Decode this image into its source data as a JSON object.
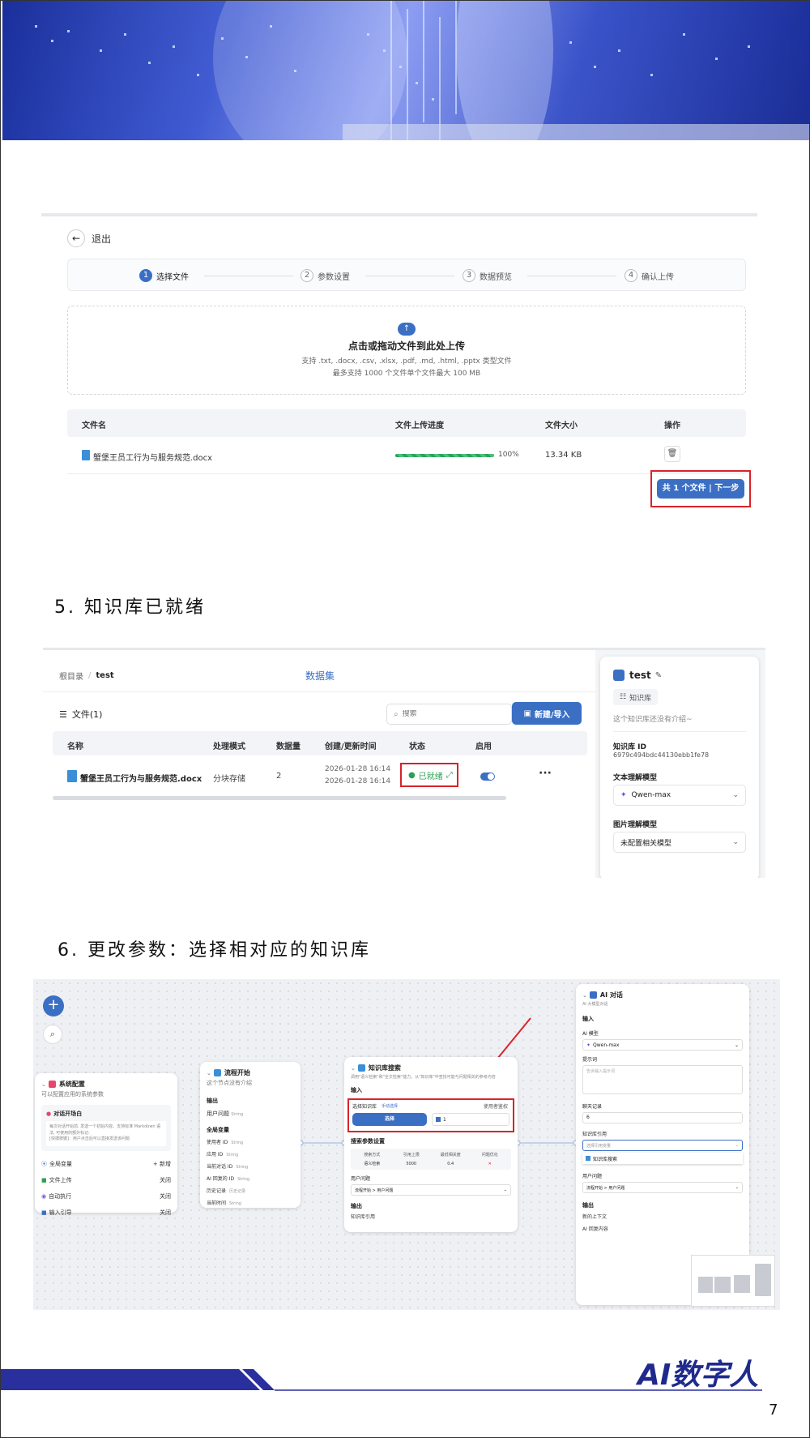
{
  "upload_screen": {
    "back_label": "退出",
    "steps": [
      "选择文件",
      "参数设置",
      "数据预览",
      "确认上传"
    ],
    "step_numbers": [
      "1",
      "2",
      "3",
      "4"
    ],
    "dropzone": {
      "title": "点击或拖动文件到此处上传",
      "line1": "支持 .txt, .docx, .csv, .xlsx, .pdf, .md, .html, .pptx 类型文件",
      "line2": "最多支持 1000 个文件单个文件最大 100 MB"
    },
    "table_headers": {
      "name": "文件名",
      "progress": "文件上传进度",
      "size": "文件大小",
      "action": "操作"
    },
    "file": {
      "name": "蟹堡王员工行为与服务规范.docx",
      "progress": 1.0,
      "progress_label": "100%",
      "size": "13.34 KB"
    },
    "next_button": "共 1 个文件 | 下一步"
  },
  "section5_title": "5. 知识库已就绪",
  "dataset_screen": {
    "breadcrumb_root": "根目录",
    "breadcrumb_current": "test",
    "tab": "数据集",
    "files_label": "文件(1)",
    "search_placeholder": "搜索",
    "new_button": "新建/导入",
    "headers": {
      "name": "名称",
      "mode": "处理模式",
      "count": "数据量",
      "time": "创建/更新时间",
      "status": "状态",
      "enabled": "启用"
    },
    "row": {
      "name": "蟹堡王员工行为与服务规范.docx",
      "mode": "分块存储",
      "count": "2",
      "created": "2026-01-28 16:14",
      "updated": "2026-01-28 16:14",
      "status": "已就绪",
      "more": "···"
    },
    "side": {
      "title": "test",
      "type": "知识库",
      "intro": "这个知识库还没有介绍~",
      "id_label": "知识库 ID",
      "id_value": "6979c494bdc44130ebb1fe78",
      "text_model_label": "文本理解模型",
      "text_model_value": "Qwen-max",
      "image_model_label": "图片理解模型",
      "image_model_value": "未配置相关模型"
    }
  },
  "section6_title": "6. 更改参数：选择相对应的知识库",
  "workflow_screen": {
    "sys_config": {
      "title": "系统配置",
      "subtitle": "可以配置应用的系统参数",
      "opening_label": "对话开场白",
      "opening_desc": "每次对话开始前, 发送一个初始内容。支持标准 Markdown 语法, 可使用的额外标记:\n[快捷按键]：用户点击后可以直接发送该问题",
      "items": [
        {
          "label": "全局变量",
          "value": "+ 新增"
        },
        {
          "label": "文件上传",
          "value": "关闭"
        },
        {
          "label": "自动执行",
          "value": "关闭"
        },
        {
          "label": "输入引导",
          "value": "关闭"
        }
      ]
    },
    "flow_start": {
      "title": "流程开始",
      "subtitle": "这个节点没有介绍",
      "output_label": "输出",
      "output_item": "用户问题",
      "global_label": "全局变量",
      "vars": [
        "使用者 ID",
        "应用 ID",
        "当前对话 ID",
        "AI 回复的 ID",
        "历史记录",
        "当前时间"
      ],
      "types": [
        "String",
        "String",
        "String",
        "String",
        "历史记录",
        "String"
      ]
    },
    "kb_search": {
      "title": "知识库搜索",
      "subtitle": "调用\"语义检索\"和\"全文检索\"能力，从\"知识库\"中查找可能与问题相关的参考内容",
      "input_label": "输入",
      "select_kb_label": "选择知识库",
      "manual_select": "手动选择",
      "auth_label": "使用者鉴权",
      "select_button": "选择",
      "selected_count": "1",
      "params_label": "搜索参数设置",
      "params_headers": [
        "搜索方式",
        "引用上限",
        "最低相关度",
        "问题优化"
      ],
      "params_values": [
        "语义检索",
        "5000",
        "0.4",
        "✕"
      ],
      "user_question": "用户问题",
      "ref_var": "流程开始 > 用户问题",
      "output_label": "输出",
      "output_item": "知识库引用"
    },
    "ai_chat": {
      "title": "AI 对话",
      "subtitle": "AI 大模型对话",
      "input_label": "输入",
      "model_label": "AI 模型",
      "model_value": "Qwen-max",
      "prompt_label": "提示词",
      "prompt_placeholder": "告诉输入提示词",
      "history_label": "聊天记录",
      "history_value": "6",
      "kb_ref_label": "知识库引用",
      "kb_ref_placeholder": "选择引用变量",
      "kb_ref_option": "知识库搜索",
      "user_question": "用户问题",
      "ref_var": "流程开始 > 用户问题",
      "output_label": "输出",
      "outputs": [
        "新的上下文",
        "AI 回复内容"
      ]
    }
  },
  "footer": {
    "brand": "AI数字人",
    "page_number": "7"
  },
  "colors": {
    "accent": "#3a6fc4",
    "highlight": "#d9232a",
    "ready": "#2e9e55",
    "brand_navy": "#1f2a8c"
  }
}
